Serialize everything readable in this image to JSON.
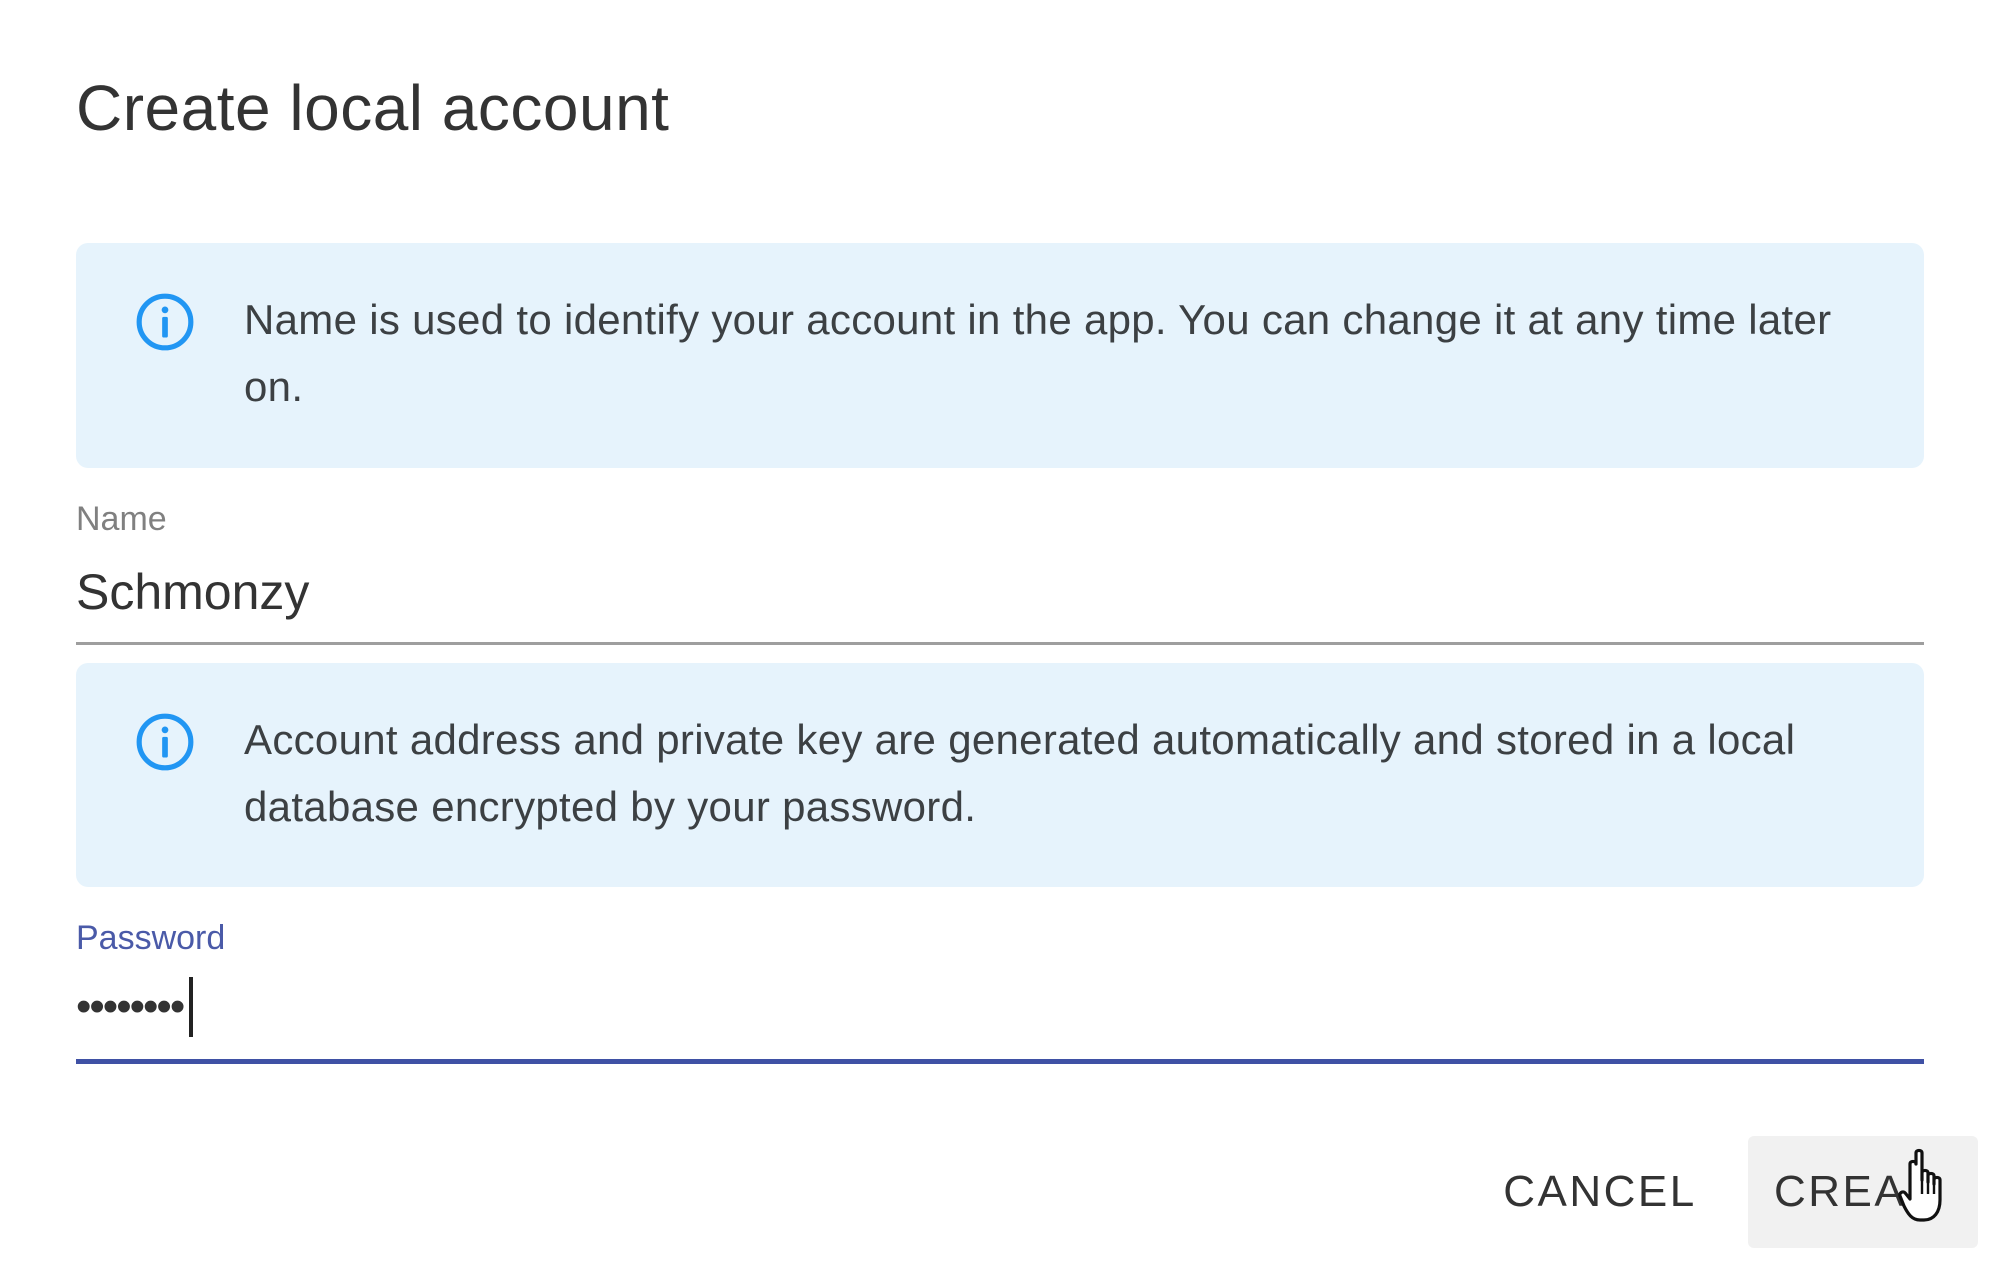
{
  "dialog": {
    "title": "Create local account",
    "info_name": {
      "icon": "info-icon",
      "text": "Name is used to identify your account in the app. You can change it at any time later on."
    },
    "name_field": {
      "label": "Name",
      "value": "Schmonzy"
    },
    "info_security": {
      "icon": "info-icon",
      "text": "Account address and private key are generated automatically and stored in a local database encrypted by your password."
    },
    "password_field": {
      "label": "Password",
      "value": "••••••••"
    },
    "actions": {
      "cancel_label": "CANCEL",
      "create_label": "CREA"
    }
  },
  "colors": {
    "info_background": "#e6f3fc",
    "info_icon": "#2196f3",
    "focus_accent": "#3f51a5",
    "text": "#333333"
  }
}
